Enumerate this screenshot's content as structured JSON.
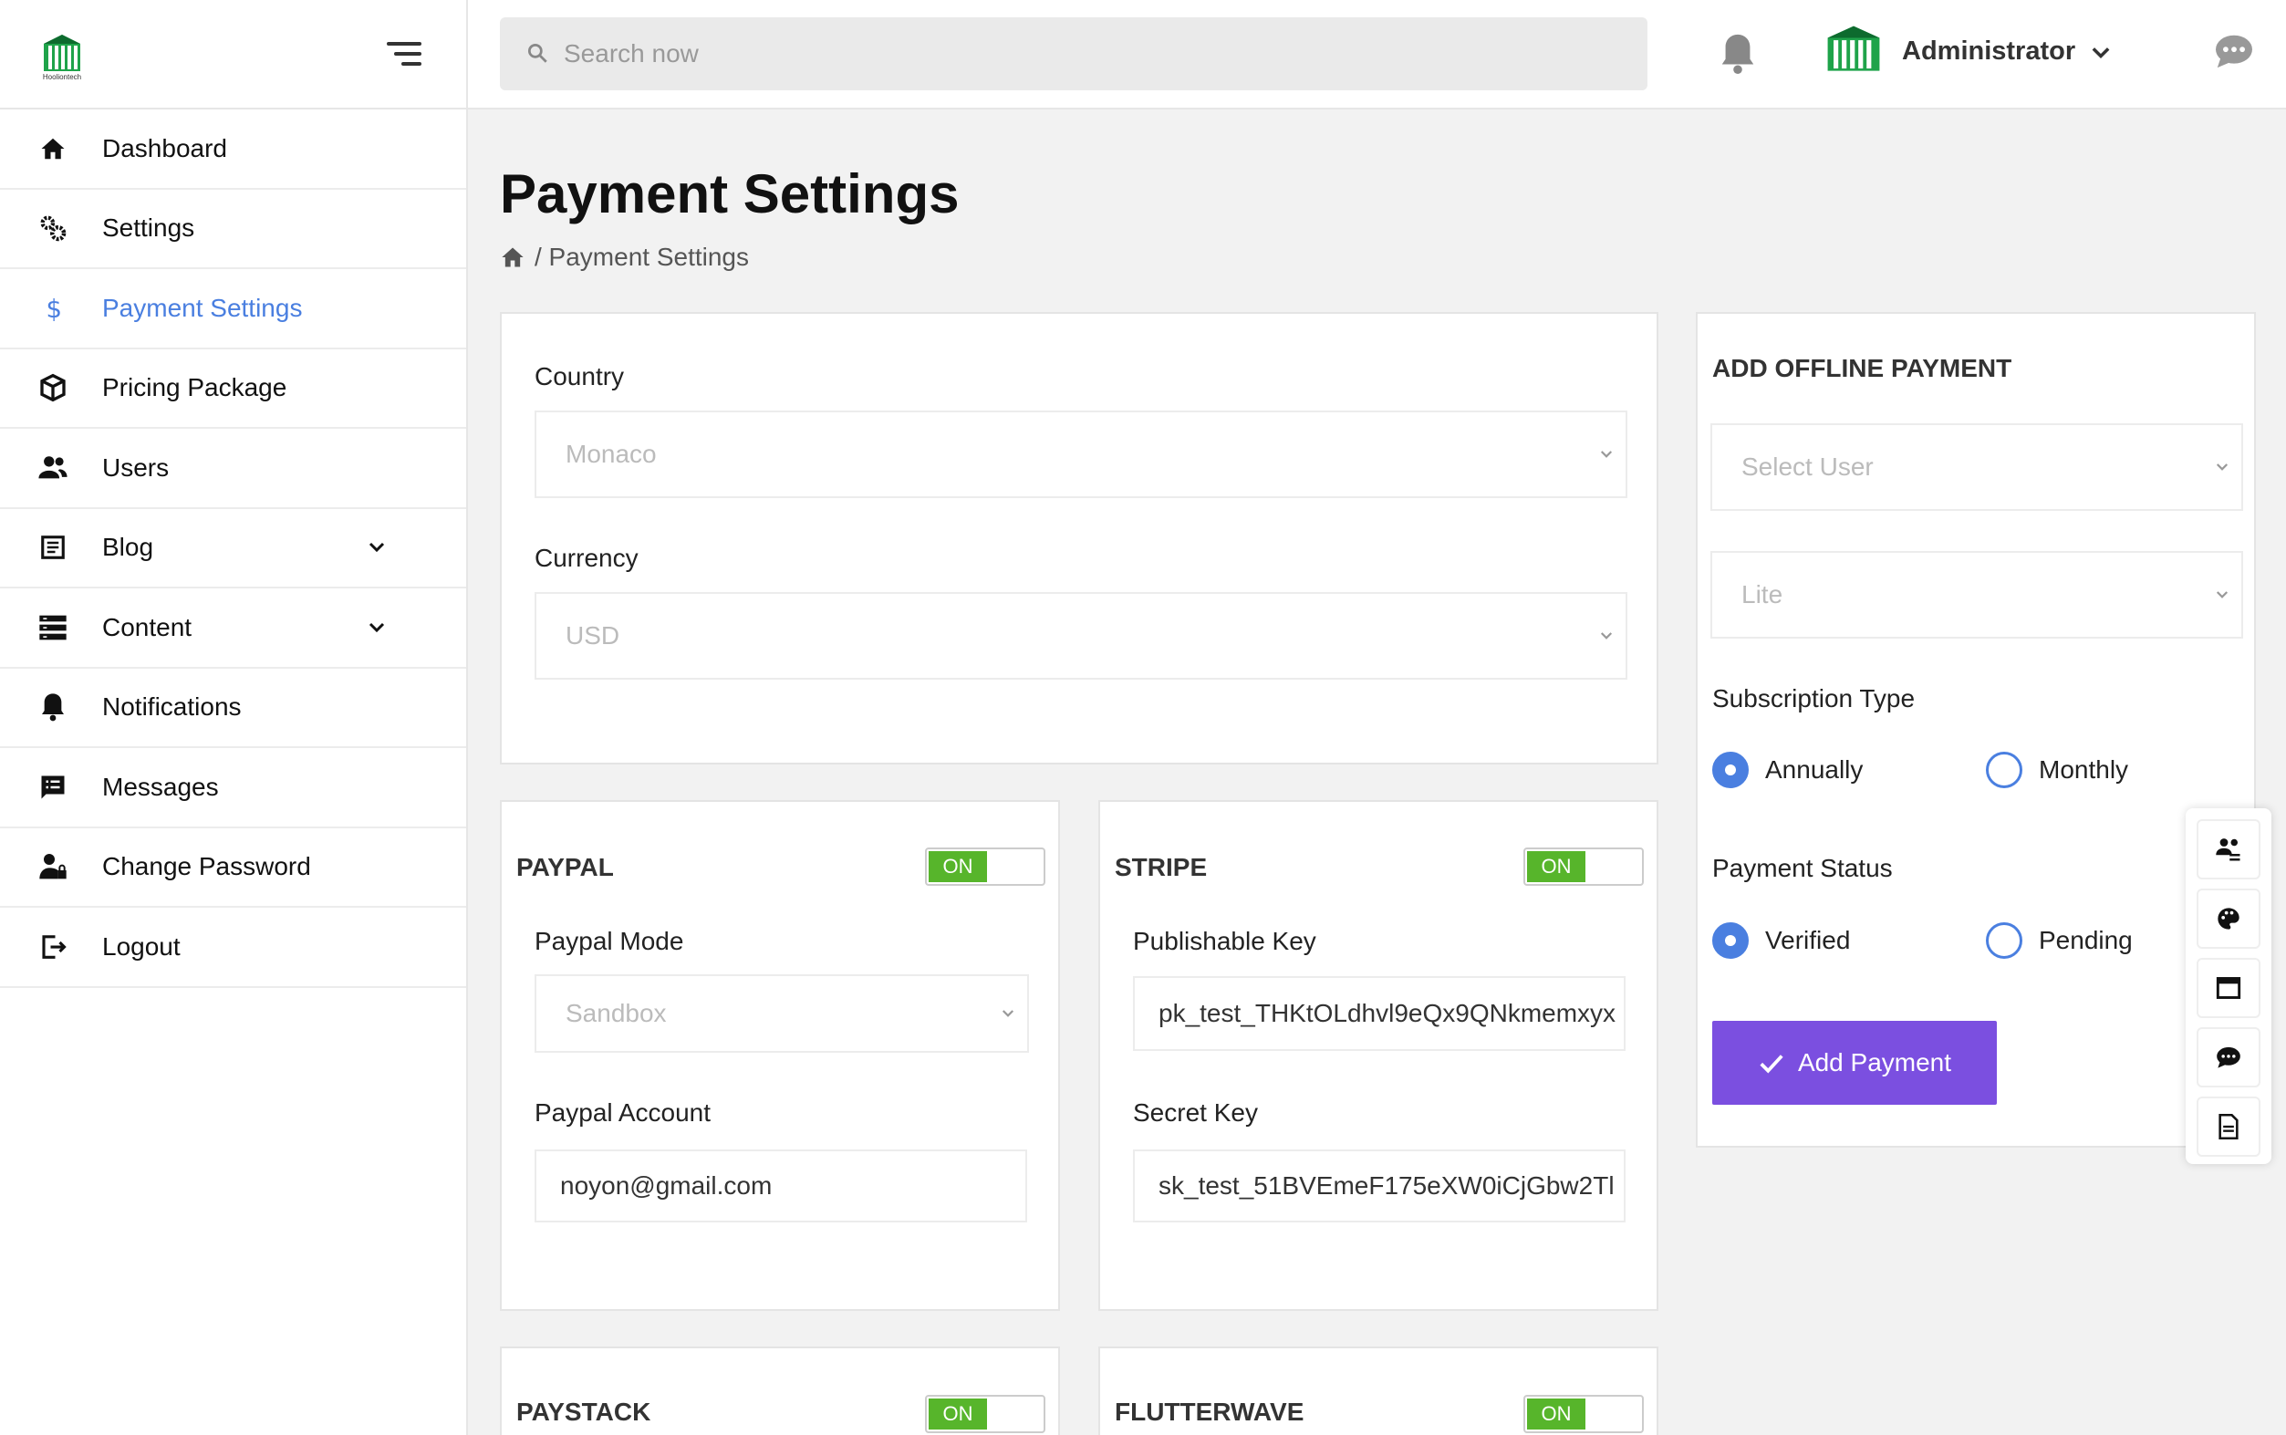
{
  "brand": {
    "logo_text": "Hooliontech"
  },
  "sidebar": {
    "items": [
      {
        "label": "Dashboard"
      },
      {
        "label": "Settings"
      },
      {
        "label": "Payment Settings"
      },
      {
        "label": "Pricing Package"
      },
      {
        "label": "Users"
      },
      {
        "label": "Blog"
      },
      {
        "label": "Content"
      },
      {
        "label": "Notifications"
      },
      {
        "label": "Messages"
      },
      {
        "label": "Change Password"
      },
      {
        "label": "Logout"
      }
    ],
    "active_color": "#4a7fe0"
  },
  "header": {
    "search_placeholder": "Search now",
    "user_name": "Administrator"
  },
  "page": {
    "title": "Payment Settings",
    "breadcrumb": "/ Payment Settings"
  },
  "general": {
    "country_label": "Country",
    "country_value": "Monaco",
    "currency_label": "Currency",
    "currency_value": "USD"
  },
  "paypal": {
    "title": "PAYPAL",
    "toggle": "ON",
    "mode_label": "Paypal Mode",
    "mode_value": "Sandbox",
    "account_label": "Paypal Account",
    "account_value": "noyon@gmail.com"
  },
  "stripe": {
    "title": "STRIPE",
    "toggle": "ON",
    "pub_label": "Publishable Key",
    "pub_value": "pk_test_THKtOLdhvl9eQx9QNkmemxyx",
    "secret_label": "Secret Key",
    "secret_value": "sk_test_51BVEmeF175eXW0iCjGbw2Tl"
  },
  "paystack": {
    "title": "PAYSTACK",
    "toggle": "ON"
  },
  "flutterwave": {
    "title": "FLUTTERWAVE",
    "toggle": "ON"
  },
  "offline": {
    "title": "ADD OFFLINE PAYMENT",
    "user_placeholder": "Select User",
    "package_value": "Lite",
    "sub_type_label": "Subscription Type",
    "sub_annually": "Annually",
    "sub_monthly": "Monthly",
    "status_label": "Payment Status",
    "status_verified": "Verified",
    "status_pending": "Pending",
    "button": "Add Payment"
  },
  "colors": {
    "toggle_on": "#57b52b",
    "button": "#7b4fe0",
    "radio": "#4a7fe0",
    "logo_green": "#1fa34a"
  }
}
